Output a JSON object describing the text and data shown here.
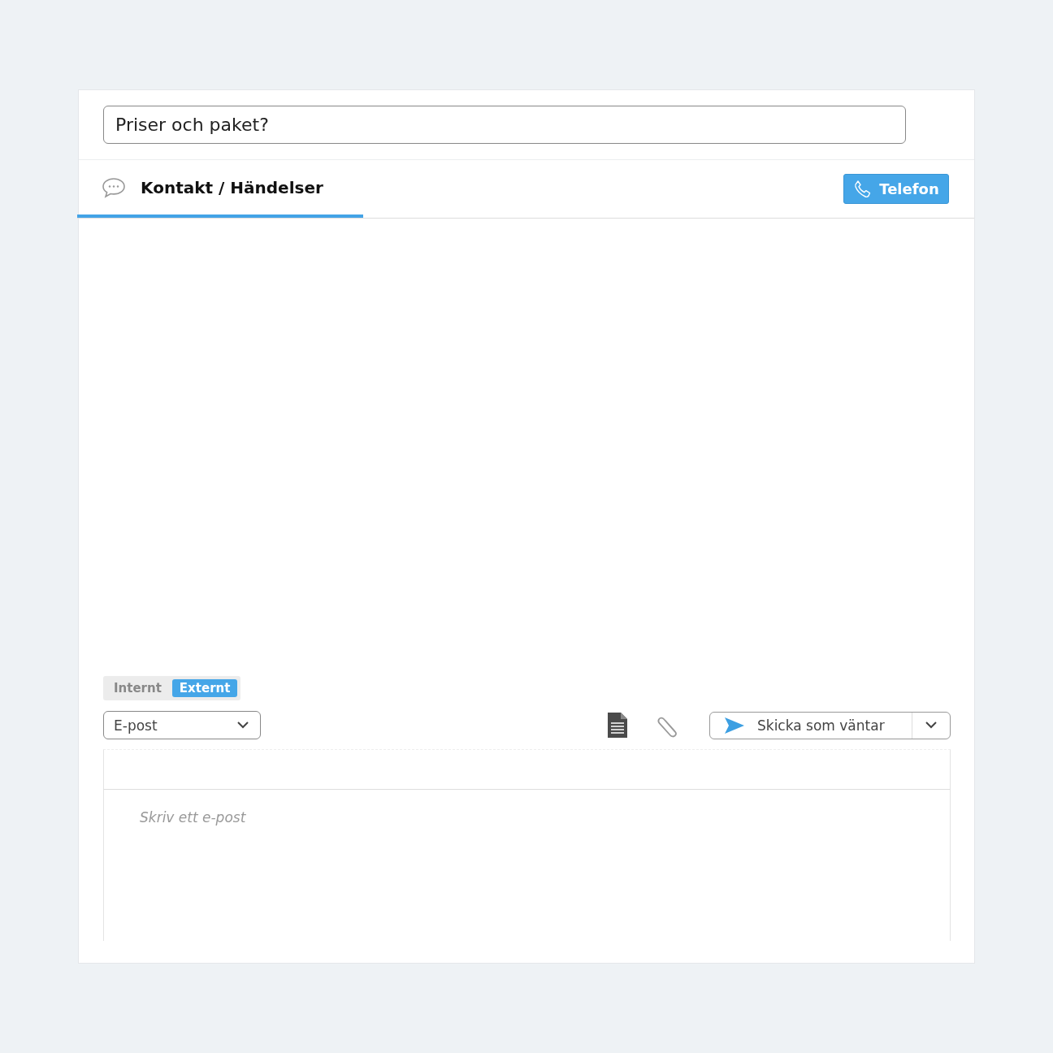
{
  "subject": {
    "value": "Priser och paket?"
  },
  "tabs": [
    {
      "label": "Kontakt / Händelser",
      "selected": true
    }
  ],
  "phone_button": {
    "label": "Telefon"
  },
  "visibility_toggle": [
    {
      "label": "Internt",
      "selected": false
    },
    {
      "label": "Externt",
      "selected": true
    }
  ],
  "channel_select": {
    "value": "E-post"
  },
  "send_button": {
    "label": "Skicka som väntar"
  },
  "editor": {
    "placeholder": "Skriv ett e-post"
  }
}
